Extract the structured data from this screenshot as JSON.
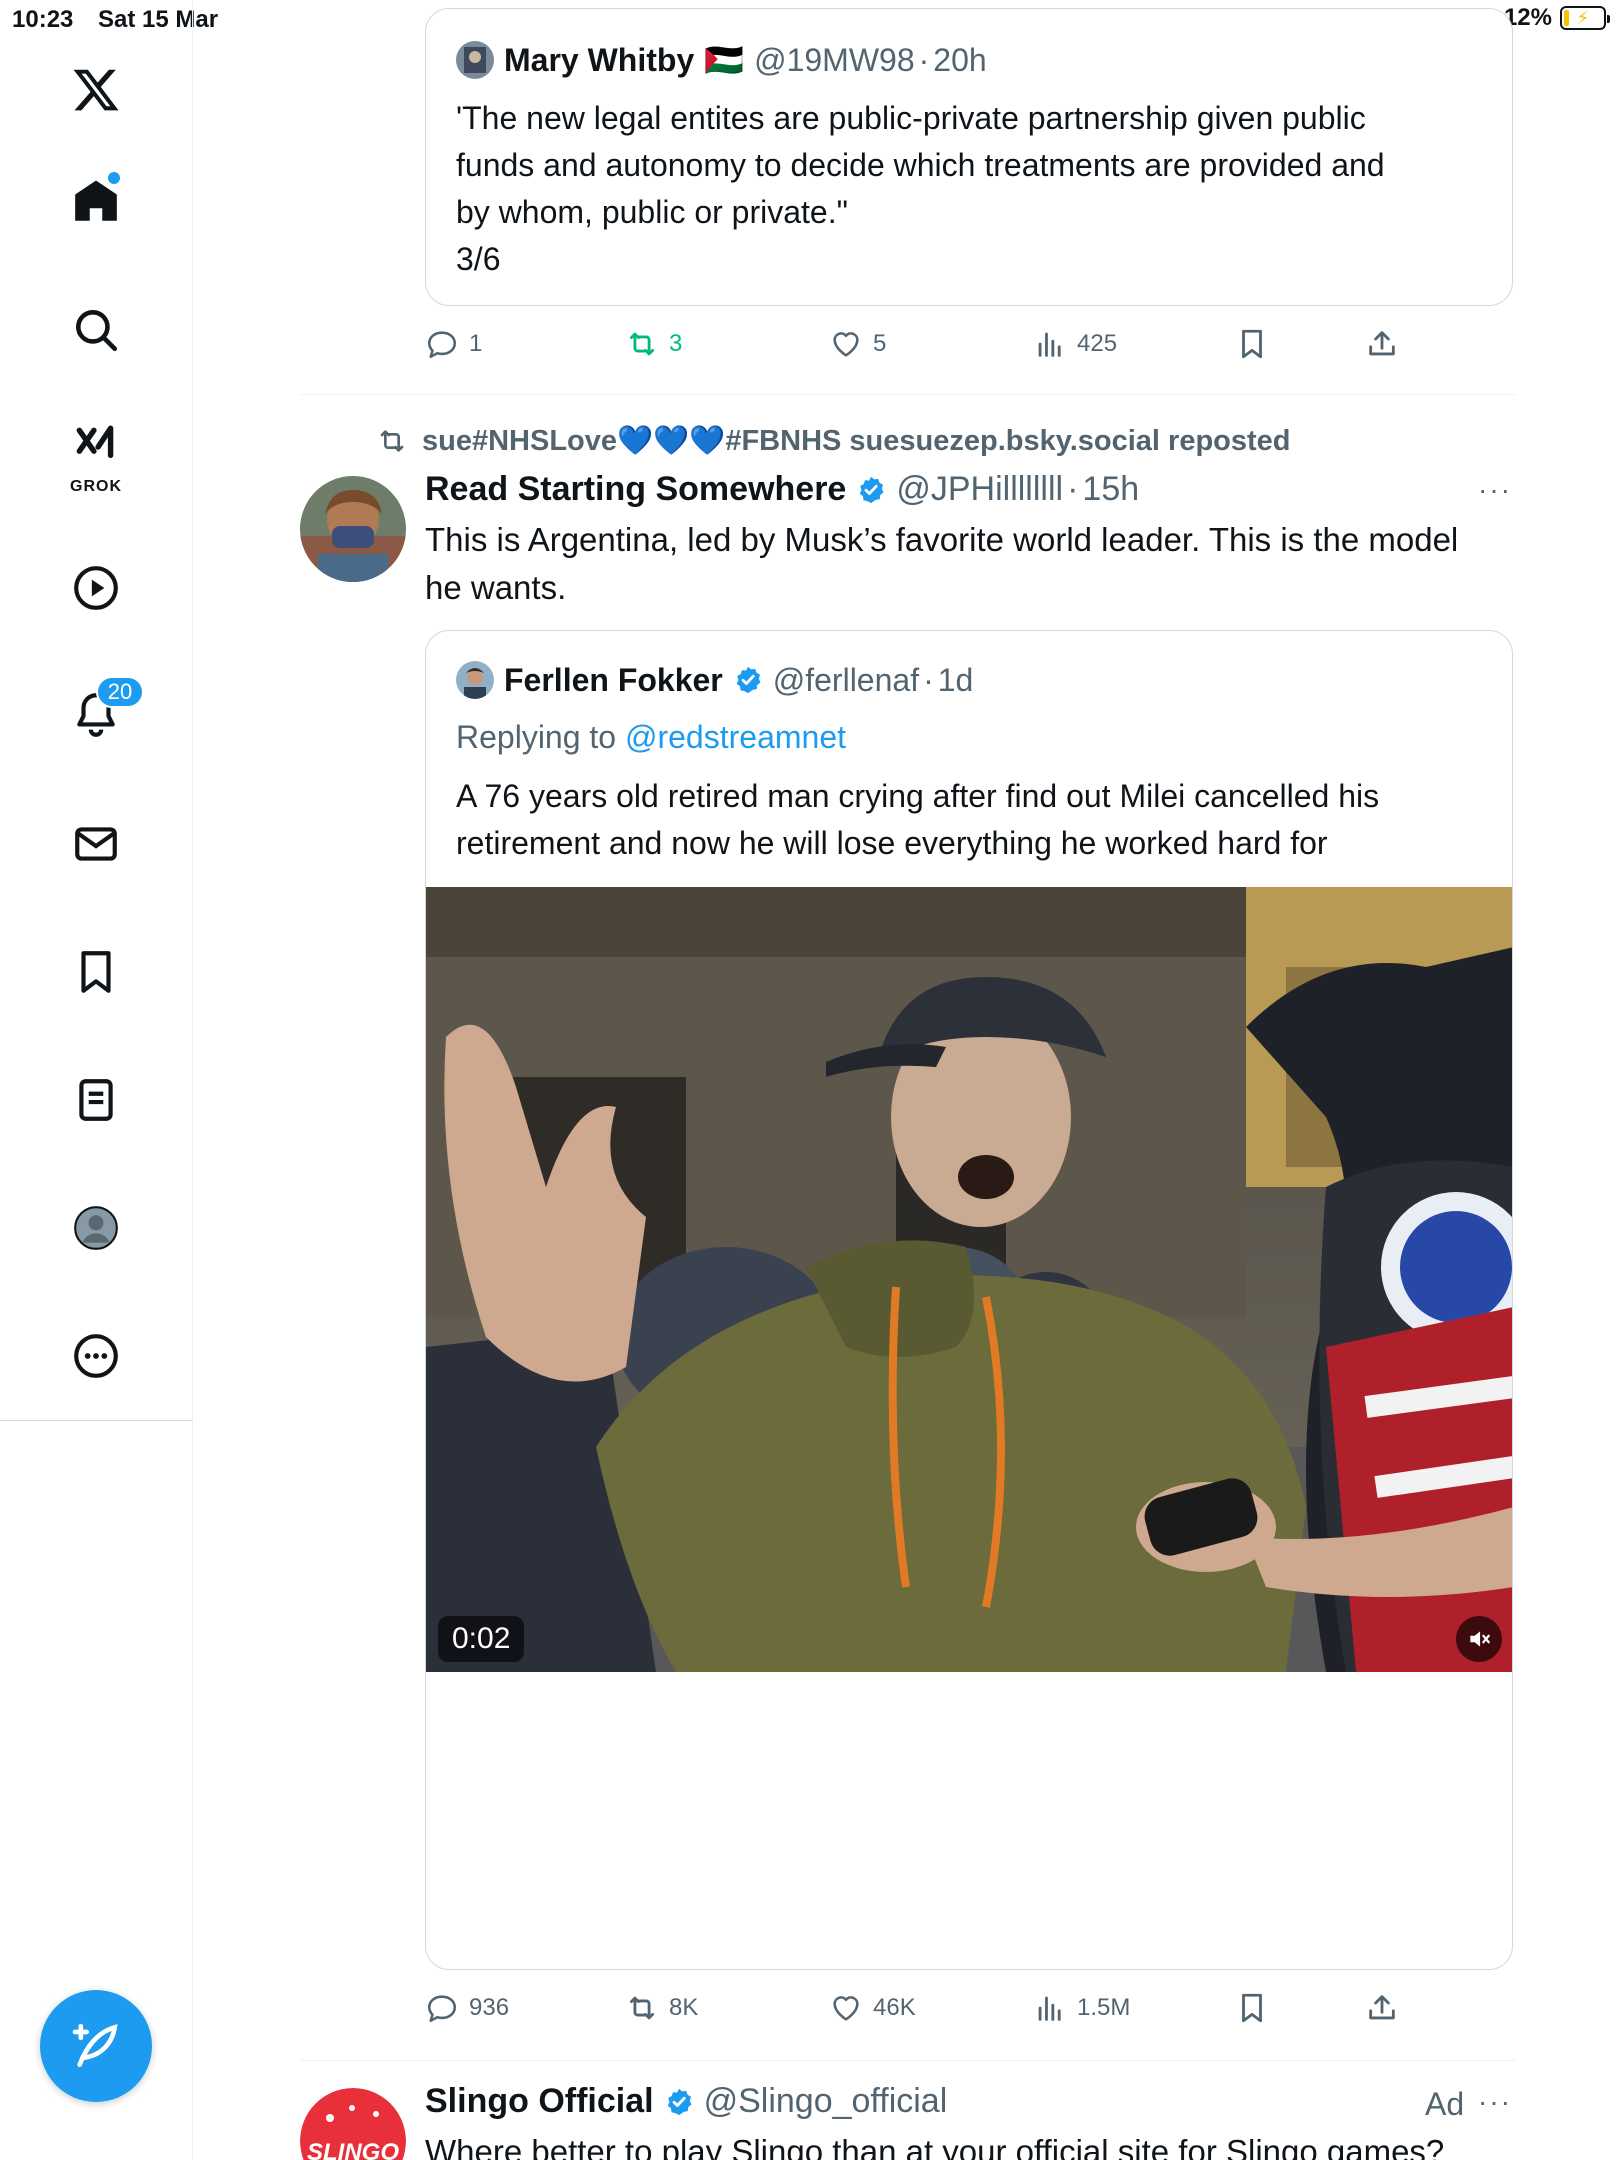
{
  "status_bar": {
    "time": "10:23",
    "date": "Sat 15 Mar",
    "battery_text": "12%",
    "center_dots": "•••"
  },
  "sidebar": {
    "items": [
      {
        "name": "x-logo",
        "label": "X"
      },
      {
        "name": "home",
        "label": "Home"
      },
      {
        "name": "search",
        "label": "Search"
      },
      {
        "name": "grok",
        "label": "GROK"
      },
      {
        "name": "videos",
        "label": "Videos"
      },
      {
        "name": "notifications",
        "label": "Notifications",
        "badge": "20"
      },
      {
        "name": "messages",
        "label": "Messages"
      },
      {
        "name": "bookmarks",
        "label": "Bookmarks"
      },
      {
        "name": "lists",
        "label": "Lists"
      },
      {
        "name": "profile",
        "label": "Profile"
      },
      {
        "name": "more",
        "label": "More"
      }
    ],
    "grok_label": "GROK",
    "notifications_badge": "20"
  },
  "post1_quote": {
    "name": "Mary Whitby",
    "flag": "🇵🇸",
    "handle": "@19MW98",
    "sep": "·",
    "time": "20h",
    "text_lines": [
      "'The new legal entites are public-private partnership given public",
      "funds and autonomy to decide which treatments are provided and",
      "by whom, public or private.\"",
      "3/6"
    ]
  },
  "post1_actions": {
    "replies": "1",
    "retweets": "3",
    "likes": "5",
    "views": "425"
  },
  "post2": {
    "repost_by": "sue#NHSLove",
    "repost_hearts": "💙💙💙",
    "repost_suffix": "#FBNHS suesuezep.bsky.social reposted",
    "name": "Read Starting Somewhere",
    "handle": "@JPHillllllll",
    "sep": "·",
    "time": "15h",
    "more": "···",
    "text_lines": [
      "This is Argentina, led by Musk’s favorite world leader. This is the model",
      "he wants."
    ],
    "quote": {
      "name": "Ferllen Fokker",
      "handle": "@ferllenaf",
      "sep": "·",
      "time": "1d",
      "replying_prefix": "Replying to",
      "replying_to": "@redstreamnet",
      "text_lines": [
        "A 76 years old retired man crying after find out Milei cancelled his",
        "retirement and now he will lose everything he worked hard for"
      ],
      "video_time": "0:02"
    },
    "actions": {
      "replies": "936",
      "retweets": "8K",
      "likes": "46K",
      "views": "1.5M"
    }
  },
  "post3": {
    "name": "Slingo Official",
    "handle": "@Slingo_official",
    "ad_label": "Ad",
    "more": "···",
    "avatar_text": "SLINGO",
    "text_partial": "Where better to play Slingo than at your official site for Slingo games?"
  },
  "colors": {
    "accent": "#1d9bf0",
    "retweet_green": "#00ba7c",
    "secondary_text": "#536471"
  }
}
